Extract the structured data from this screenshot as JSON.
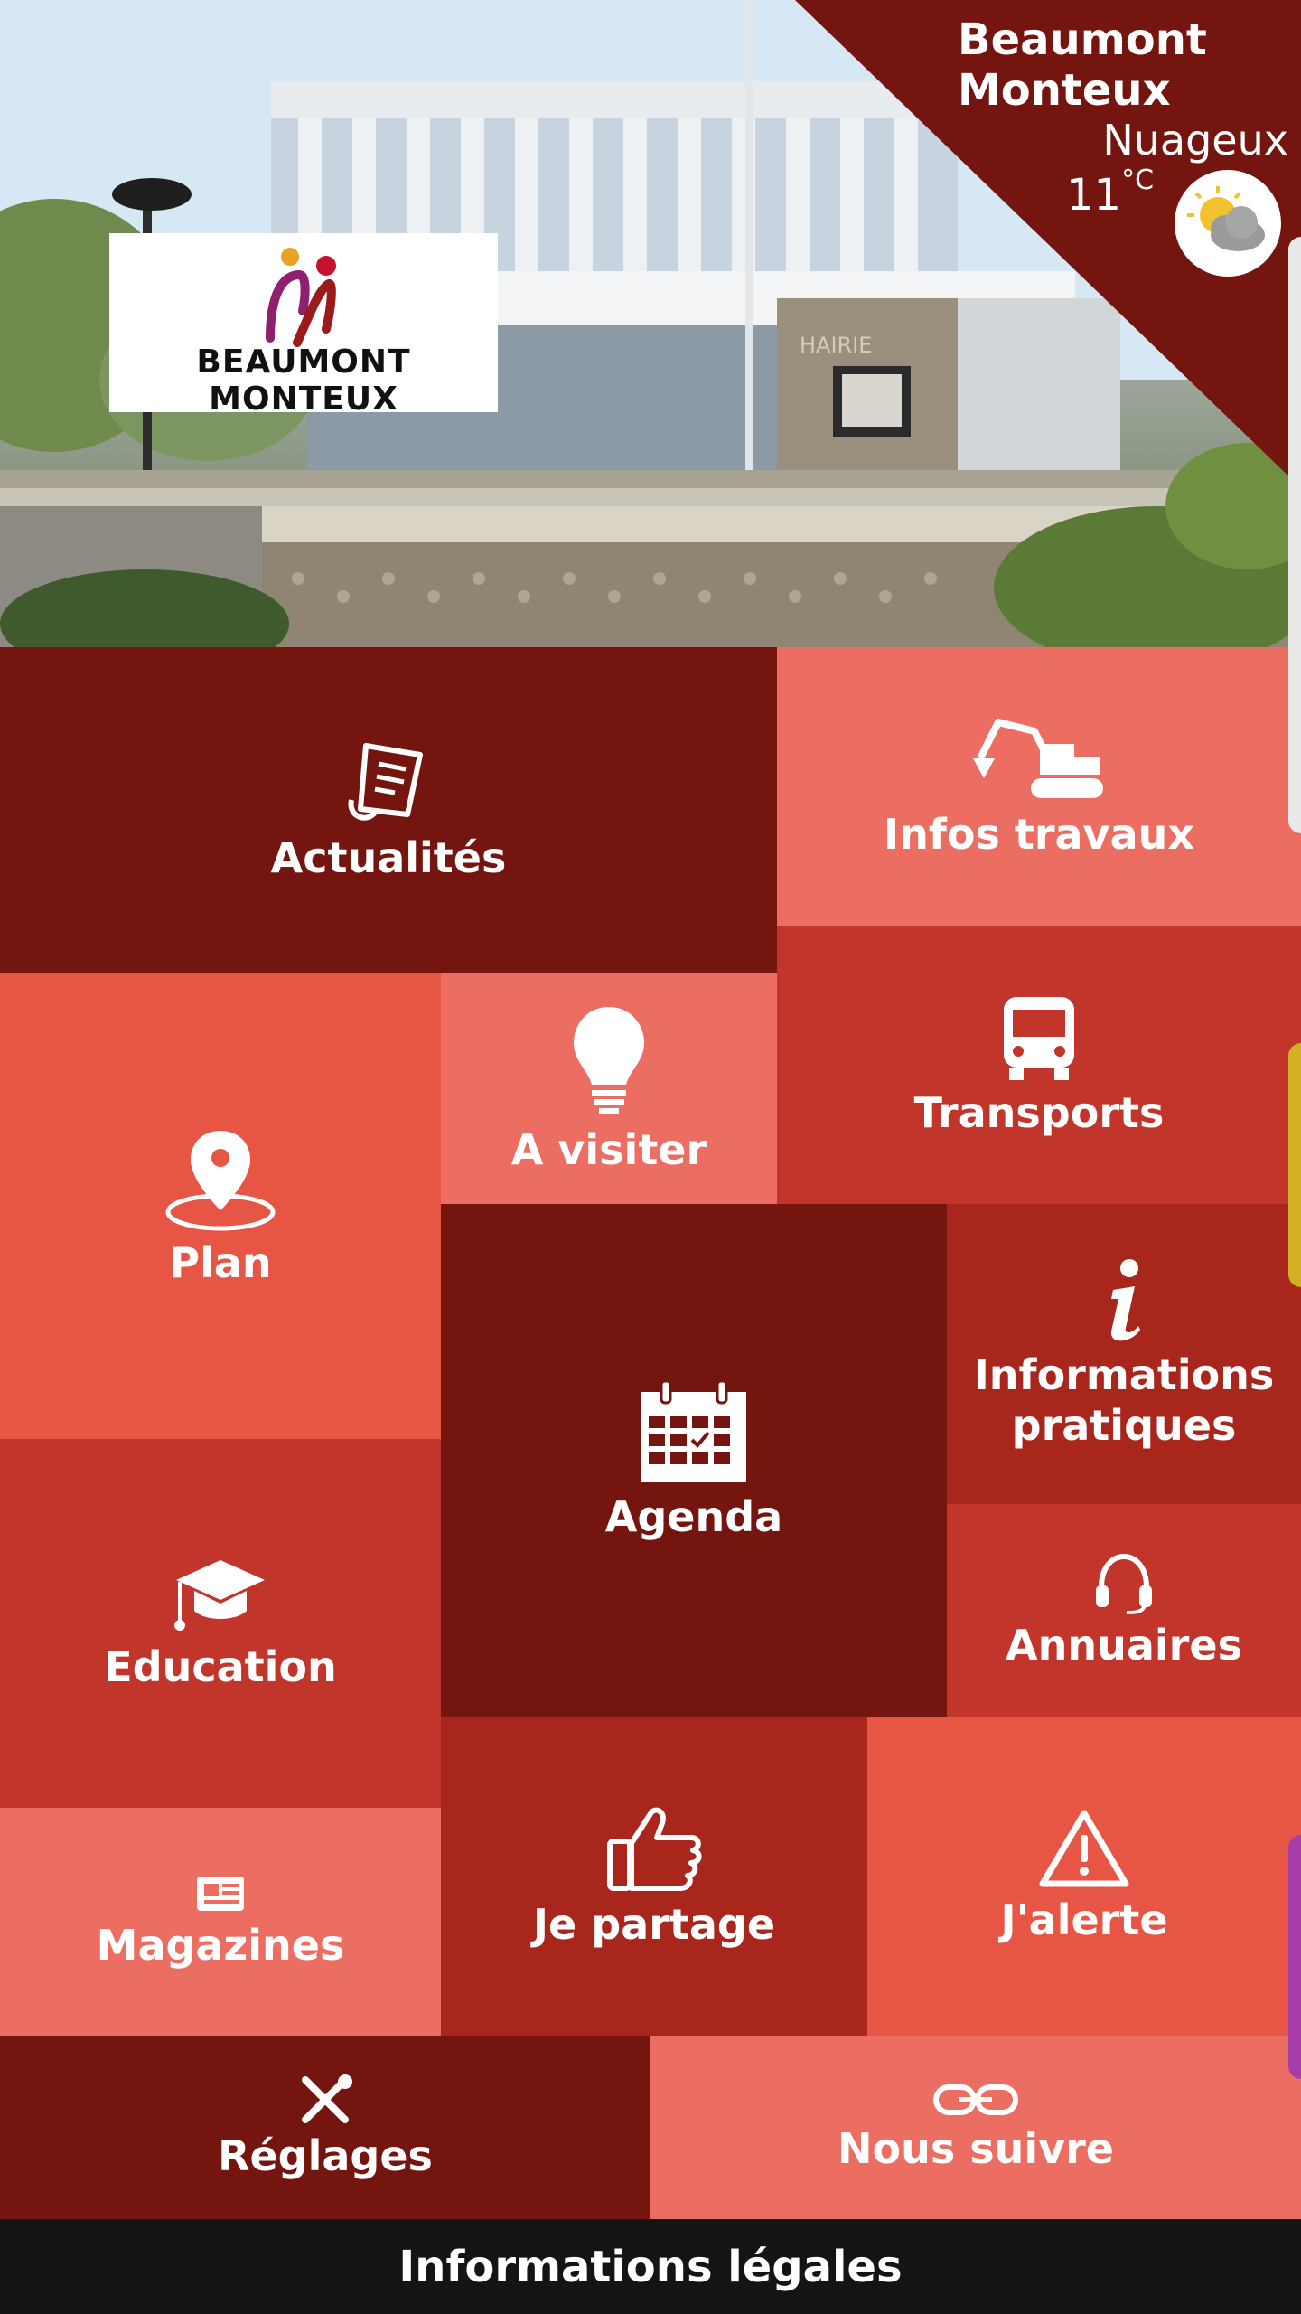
{
  "header": {
    "logo_text": "BEAUMONT MONTEUX",
    "weather": {
      "city_line1": "Beaumont",
      "city_line2": "Monteux",
      "condition": "Nuageux",
      "temperature": "11",
      "unit": "°C",
      "icon": "cloud-sun-icon"
    },
    "photo_sign": "HAIRIE"
  },
  "tiles": {
    "actualites": {
      "label": "Actualités",
      "icon": "news-scroll-icon"
    },
    "infos_travaux": {
      "label": "Infos travaux",
      "icon": "excavator-icon"
    },
    "plan": {
      "label": "Plan",
      "icon": "map-pin-icon"
    },
    "a_visiter": {
      "label": "A visiter",
      "icon": "lightbulb-icon"
    },
    "transports": {
      "label": "Transports",
      "icon": "bus-icon"
    },
    "agenda": {
      "label": "Agenda",
      "icon": "calendar-icon"
    },
    "informations_pratiques": {
      "label": "Informations\npratiques",
      "icon": "info-icon"
    },
    "annuaires": {
      "label": "Annuaires",
      "icon": "headset-icon"
    },
    "education": {
      "label": "Education",
      "icon": "graduation-cap-icon"
    },
    "magazines": {
      "label": "Magazines",
      "icon": "newspaper-icon"
    },
    "je_partage": {
      "label": "Je partage",
      "icon": "thumbs-up-icon"
    },
    "j_alerte": {
      "label": "J'alerte",
      "icon": "warning-icon"
    },
    "reglages": {
      "label": "Réglages",
      "icon": "tools-icon"
    },
    "nous_suivre": {
      "label": "Nous suivre",
      "icon": "link-icon"
    }
  },
  "footer": {
    "label": "Informations légales"
  },
  "colors": {
    "dark_red": "#75150f",
    "salmon": "#ec6d62",
    "red": "#c1352b",
    "coral": "#e75645",
    "crimson": "#a9261d"
  }
}
